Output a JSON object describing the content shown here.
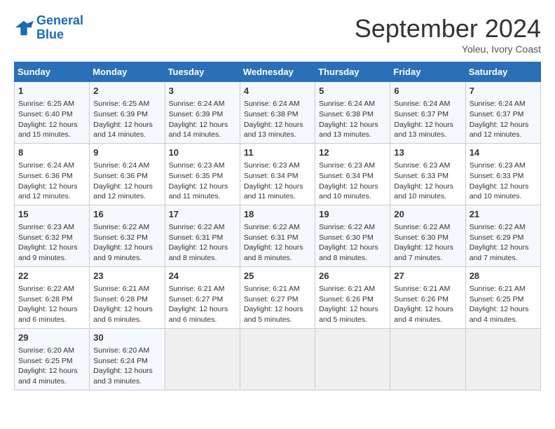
{
  "logo": {
    "line1": "General",
    "line2": "Blue"
  },
  "title": "September 2024",
  "location": "Yoleu, Ivory Coast",
  "headers": [
    "Sunday",
    "Monday",
    "Tuesday",
    "Wednesday",
    "Thursday",
    "Friday",
    "Saturday"
  ],
  "weeks": [
    [
      {
        "day": "1",
        "info": "Sunrise: 6:25 AM\nSunset: 6:40 PM\nDaylight: 12 hours\nand 15 minutes."
      },
      {
        "day": "2",
        "info": "Sunrise: 6:25 AM\nSunset: 6:39 PM\nDaylight: 12 hours\nand 14 minutes."
      },
      {
        "day": "3",
        "info": "Sunrise: 6:24 AM\nSunset: 6:39 PM\nDaylight: 12 hours\nand 14 minutes."
      },
      {
        "day": "4",
        "info": "Sunrise: 6:24 AM\nSunset: 6:38 PM\nDaylight: 12 hours\nand 13 minutes."
      },
      {
        "day": "5",
        "info": "Sunrise: 6:24 AM\nSunset: 6:38 PM\nDaylight: 12 hours\nand 13 minutes."
      },
      {
        "day": "6",
        "info": "Sunrise: 6:24 AM\nSunset: 6:37 PM\nDaylight: 12 hours\nand 13 minutes."
      },
      {
        "day": "7",
        "info": "Sunrise: 6:24 AM\nSunset: 6:37 PM\nDaylight: 12 hours\nand 12 minutes."
      }
    ],
    [
      {
        "day": "8",
        "info": "Sunrise: 6:24 AM\nSunset: 6:36 PM\nDaylight: 12 hours\nand 12 minutes."
      },
      {
        "day": "9",
        "info": "Sunrise: 6:24 AM\nSunset: 6:36 PM\nDaylight: 12 hours\nand 12 minutes."
      },
      {
        "day": "10",
        "info": "Sunrise: 6:23 AM\nSunset: 6:35 PM\nDaylight: 12 hours\nand 11 minutes."
      },
      {
        "day": "11",
        "info": "Sunrise: 6:23 AM\nSunset: 6:34 PM\nDaylight: 12 hours\nand 11 minutes."
      },
      {
        "day": "12",
        "info": "Sunrise: 6:23 AM\nSunset: 6:34 PM\nDaylight: 12 hours\nand 10 minutes."
      },
      {
        "day": "13",
        "info": "Sunrise: 6:23 AM\nSunset: 6:33 PM\nDaylight: 12 hours\nand 10 minutes."
      },
      {
        "day": "14",
        "info": "Sunrise: 6:23 AM\nSunset: 6:33 PM\nDaylight: 12 hours\nand 10 minutes."
      }
    ],
    [
      {
        "day": "15",
        "info": "Sunrise: 6:23 AM\nSunset: 6:32 PM\nDaylight: 12 hours\nand 9 minutes."
      },
      {
        "day": "16",
        "info": "Sunrise: 6:22 AM\nSunset: 6:32 PM\nDaylight: 12 hours\nand 9 minutes."
      },
      {
        "day": "17",
        "info": "Sunrise: 6:22 AM\nSunset: 6:31 PM\nDaylight: 12 hours\nand 8 minutes."
      },
      {
        "day": "18",
        "info": "Sunrise: 6:22 AM\nSunset: 6:31 PM\nDaylight: 12 hours\nand 8 minutes."
      },
      {
        "day": "19",
        "info": "Sunrise: 6:22 AM\nSunset: 6:30 PM\nDaylight: 12 hours\nand 8 minutes."
      },
      {
        "day": "20",
        "info": "Sunrise: 6:22 AM\nSunset: 6:30 PM\nDaylight: 12 hours\nand 7 minutes."
      },
      {
        "day": "21",
        "info": "Sunrise: 6:22 AM\nSunset: 6:29 PM\nDaylight: 12 hours\nand 7 minutes."
      }
    ],
    [
      {
        "day": "22",
        "info": "Sunrise: 6:22 AM\nSunset: 6:28 PM\nDaylight: 12 hours\nand 6 minutes."
      },
      {
        "day": "23",
        "info": "Sunrise: 6:21 AM\nSunset: 6:28 PM\nDaylight: 12 hours\nand 6 minutes."
      },
      {
        "day": "24",
        "info": "Sunrise: 6:21 AM\nSunset: 6:27 PM\nDaylight: 12 hours\nand 6 minutes."
      },
      {
        "day": "25",
        "info": "Sunrise: 6:21 AM\nSunset: 6:27 PM\nDaylight: 12 hours\nand 5 minutes."
      },
      {
        "day": "26",
        "info": "Sunrise: 6:21 AM\nSunset: 6:26 PM\nDaylight: 12 hours\nand 5 minutes."
      },
      {
        "day": "27",
        "info": "Sunrise: 6:21 AM\nSunset: 6:26 PM\nDaylight: 12 hours\nand 4 minutes."
      },
      {
        "day": "28",
        "info": "Sunrise: 6:21 AM\nSunset: 6:25 PM\nDaylight: 12 hours\nand 4 minutes."
      }
    ],
    [
      {
        "day": "29",
        "info": "Sunrise: 6:20 AM\nSunset: 6:25 PM\nDaylight: 12 hours\nand 4 minutes."
      },
      {
        "day": "30",
        "info": "Sunrise: 6:20 AM\nSunset: 6:24 PM\nDaylight: 12 hours\nand 3 minutes."
      },
      {
        "day": "",
        "info": ""
      },
      {
        "day": "",
        "info": ""
      },
      {
        "day": "",
        "info": ""
      },
      {
        "day": "",
        "info": ""
      },
      {
        "day": "",
        "info": ""
      }
    ]
  ]
}
